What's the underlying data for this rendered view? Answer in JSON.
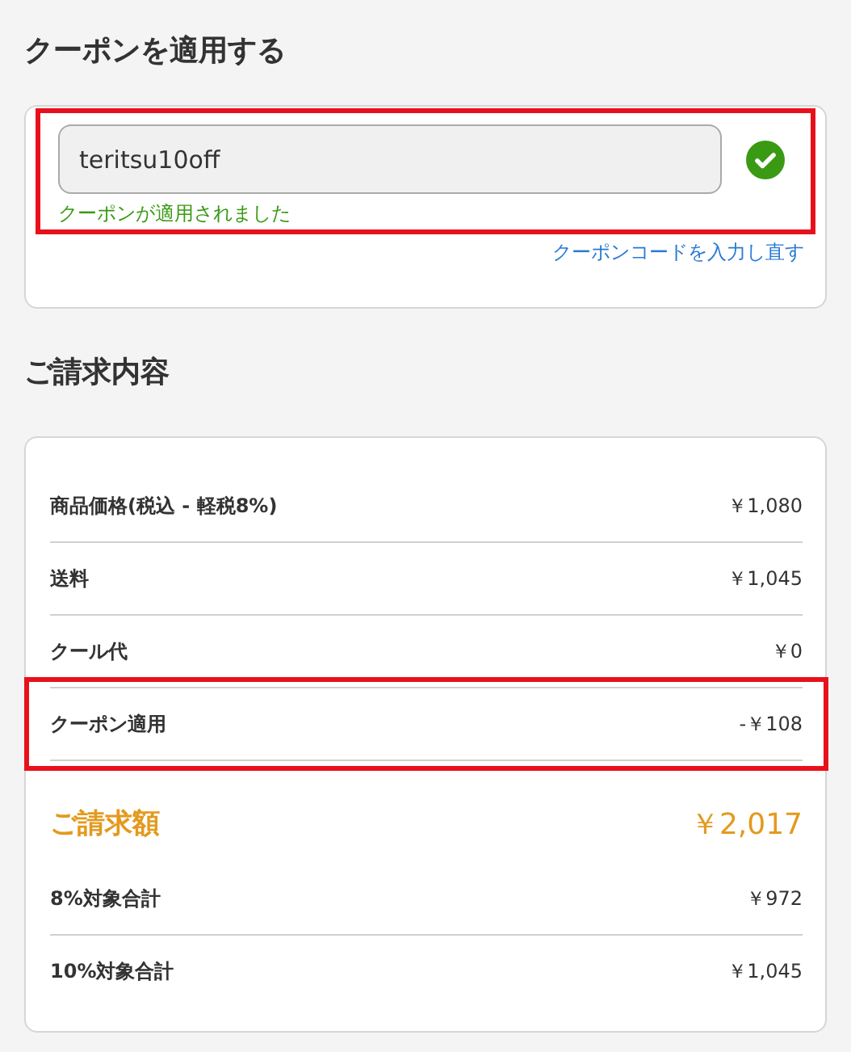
{
  "coupon_section": {
    "heading": "クーポンを適用する",
    "code_field": {
      "value": "teritsu10off"
    },
    "applied": true,
    "message": "クーポンが適用されました",
    "reenter_link": "クーポンコードを入力し直す",
    "highlighted": true
  },
  "billing_section": {
    "heading": "ご請求内容",
    "rows": [
      {
        "kind": "line",
        "label": "商品価格(税込 - 軽税8%)",
        "amount": "￥1,080",
        "highlighted": false
      },
      {
        "kind": "line",
        "label": "送料",
        "amount": "￥1,045",
        "highlighted": false
      },
      {
        "kind": "line",
        "label": "クール代",
        "amount": "￥0",
        "highlighted": false
      },
      {
        "kind": "line",
        "label": "クーポン適用",
        "amount": "-￥108",
        "highlighted": true
      },
      {
        "kind": "total",
        "label": "ご請求額",
        "amount": "￥2,017",
        "highlighted": false
      },
      {
        "kind": "line",
        "label": "8%対象合計",
        "amount": "￥972",
        "highlighted": false
      },
      {
        "kind": "last",
        "label": "10%対象合計",
        "amount": "￥1,045",
        "highlighted": false
      }
    ]
  }
}
